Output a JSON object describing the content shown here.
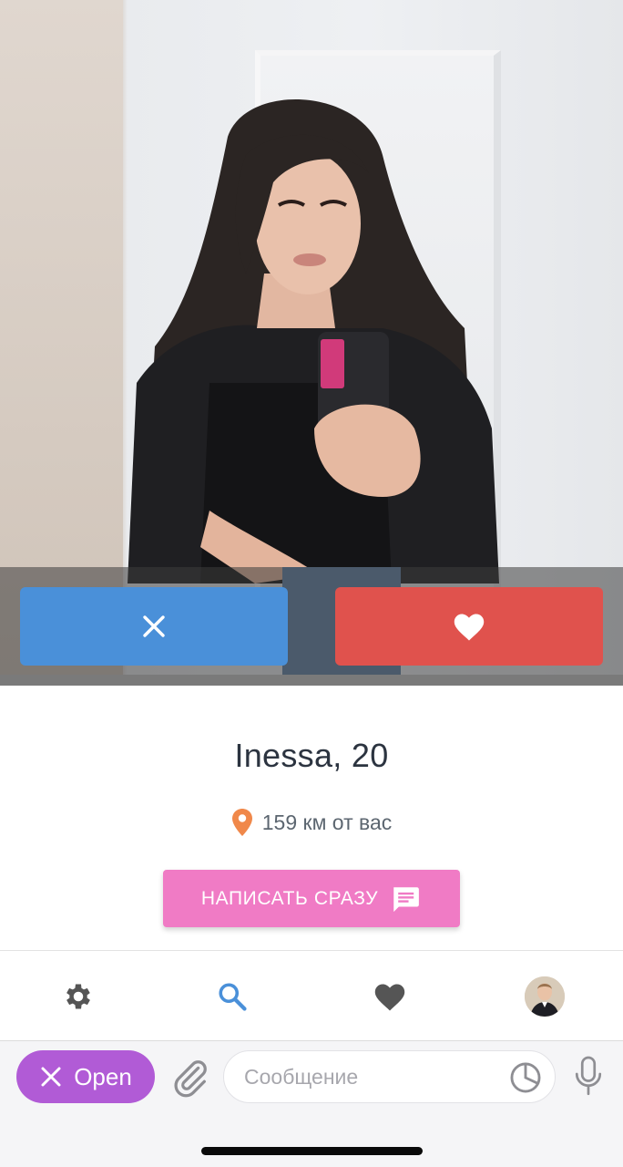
{
  "profile": {
    "name_age": "Inessa, 20",
    "distance": "159 км от вас",
    "write_button_label": "НАПИСАТЬ СРАЗУ"
  },
  "actions": {
    "dislike_icon": "close-icon",
    "like_icon": "heart-icon"
  },
  "nav": {
    "items": [
      "settings-icon",
      "search-icon",
      "heart-icon",
      "avatar"
    ]
  },
  "composer": {
    "open_label": "Open",
    "message_placeholder": "Сообщение"
  },
  "colors": {
    "dislike": "#4a90d9",
    "like": "#e0524d",
    "write_button": "#f07bc5",
    "pin": "#f0884a",
    "nav_active": "#4a90d9",
    "open_button": "#b15bd6"
  }
}
